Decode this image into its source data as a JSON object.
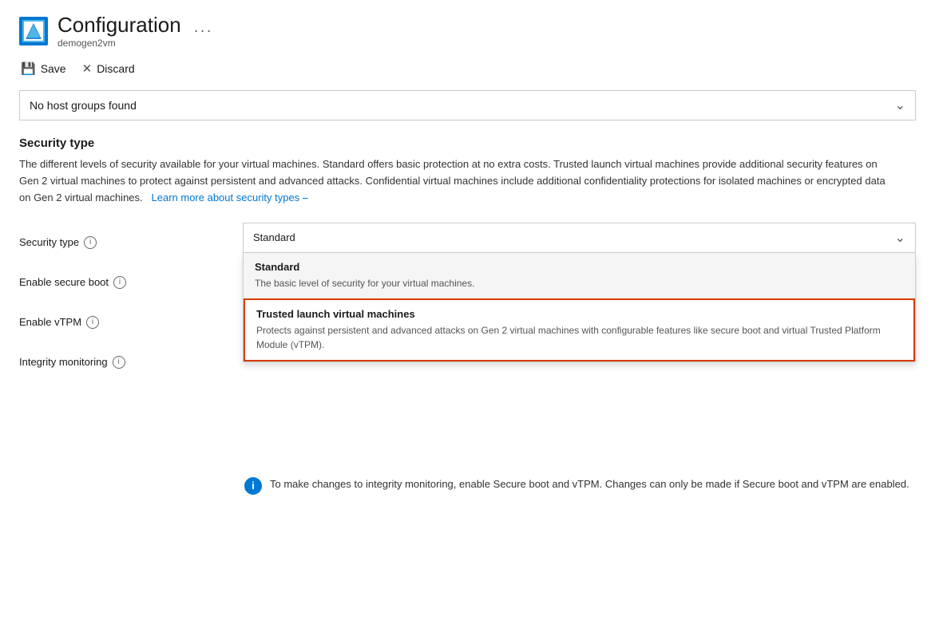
{
  "header": {
    "title": "Configuration",
    "subtitle": "demogen2vm",
    "more_icon": "···"
  },
  "toolbar": {
    "save_label": "Save",
    "discard_label": "Discard"
  },
  "host_groups_dropdown": {
    "value": "No host groups found",
    "placeholder": "No host groups found"
  },
  "security_section": {
    "title": "Security type",
    "description": "The different levels of security available for your virtual machines. Standard offers basic protection at no extra costs. Trusted launch virtual machines provide additional security features on Gen 2 virtual machines to protect against persistent and advanced attacks. Confidential virtual machines include additional confidentiality protections for isolated machines or encrypted data on Gen 2 virtual machines.",
    "learn_more_text": "Learn more about security types",
    "learn_more_icon": "↗"
  },
  "form": {
    "labels": [
      {
        "id": "security-type",
        "text": "Security type",
        "has_info": true
      },
      {
        "id": "enable-secure-boot",
        "text": "Enable secure boot",
        "has_info": true
      },
      {
        "id": "enable-vtpm",
        "text": "Enable vTPM",
        "has_info": true
      },
      {
        "id": "integrity-monitoring",
        "text": "Integrity monitoring",
        "has_info": true
      }
    ],
    "security_type_value": "Standard"
  },
  "dropdown_options": [
    {
      "id": "standard",
      "title": "Standard",
      "description": "The basic level of security for your virtual machines.",
      "is_selected": true,
      "is_highlighted": false
    },
    {
      "id": "trusted-launch",
      "title": "Trusted launch virtual machines",
      "description": "Protects against persistent and advanced attacks on Gen 2 virtual machines with configurable features like secure boot and virtual Trusted Platform Module (vTPM).",
      "is_selected": false,
      "is_highlighted": true
    }
  ],
  "info_banner": {
    "text": "To make changes to integrity monitoring, enable Secure boot and vTPM. Changes can only be made if Secure boot and vTPM are enabled."
  }
}
